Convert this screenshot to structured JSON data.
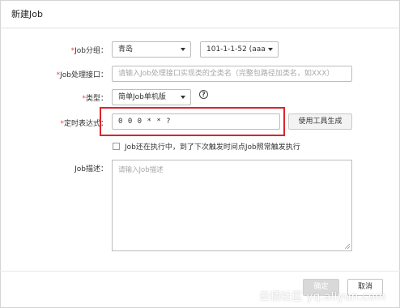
{
  "dialog": {
    "title": "新建Job"
  },
  "form": {
    "required_mark": "*",
    "group": {
      "label": "Job分组：",
      "value": "青岛",
      "instance_value": "101-1-1-52 (aaa"
    },
    "handler": {
      "label": "Job处理接口：",
      "placeholder": "请输入Job处理接口实现类的全类名（完整包路径加类名，如XXX）"
    },
    "type": {
      "label": "类型：",
      "value": "简单Job单机版",
      "help_glyph": "?"
    },
    "cron": {
      "label": "定时表达式：",
      "value": "0 0 0 * * ?",
      "generate_label": "使用工具生成"
    },
    "trigger_checkbox": {
      "label": "Job还在执行中，到了下次触发时间点Job照常触发执行",
      "checked": false
    },
    "description": {
      "label": "Job描述：",
      "placeholder": "请输入Job描述"
    }
  },
  "footer": {
    "ok_label": "确定",
    "cancel_label": "取消"
  },
  "watermark": "云栖社区 yq.aliyun.com",
  "colors": {
    "required": "#e5483a",
    "highlight_border": "#d9252e",
    "ok_button_bg": "#d9d9d9"
  }
}
